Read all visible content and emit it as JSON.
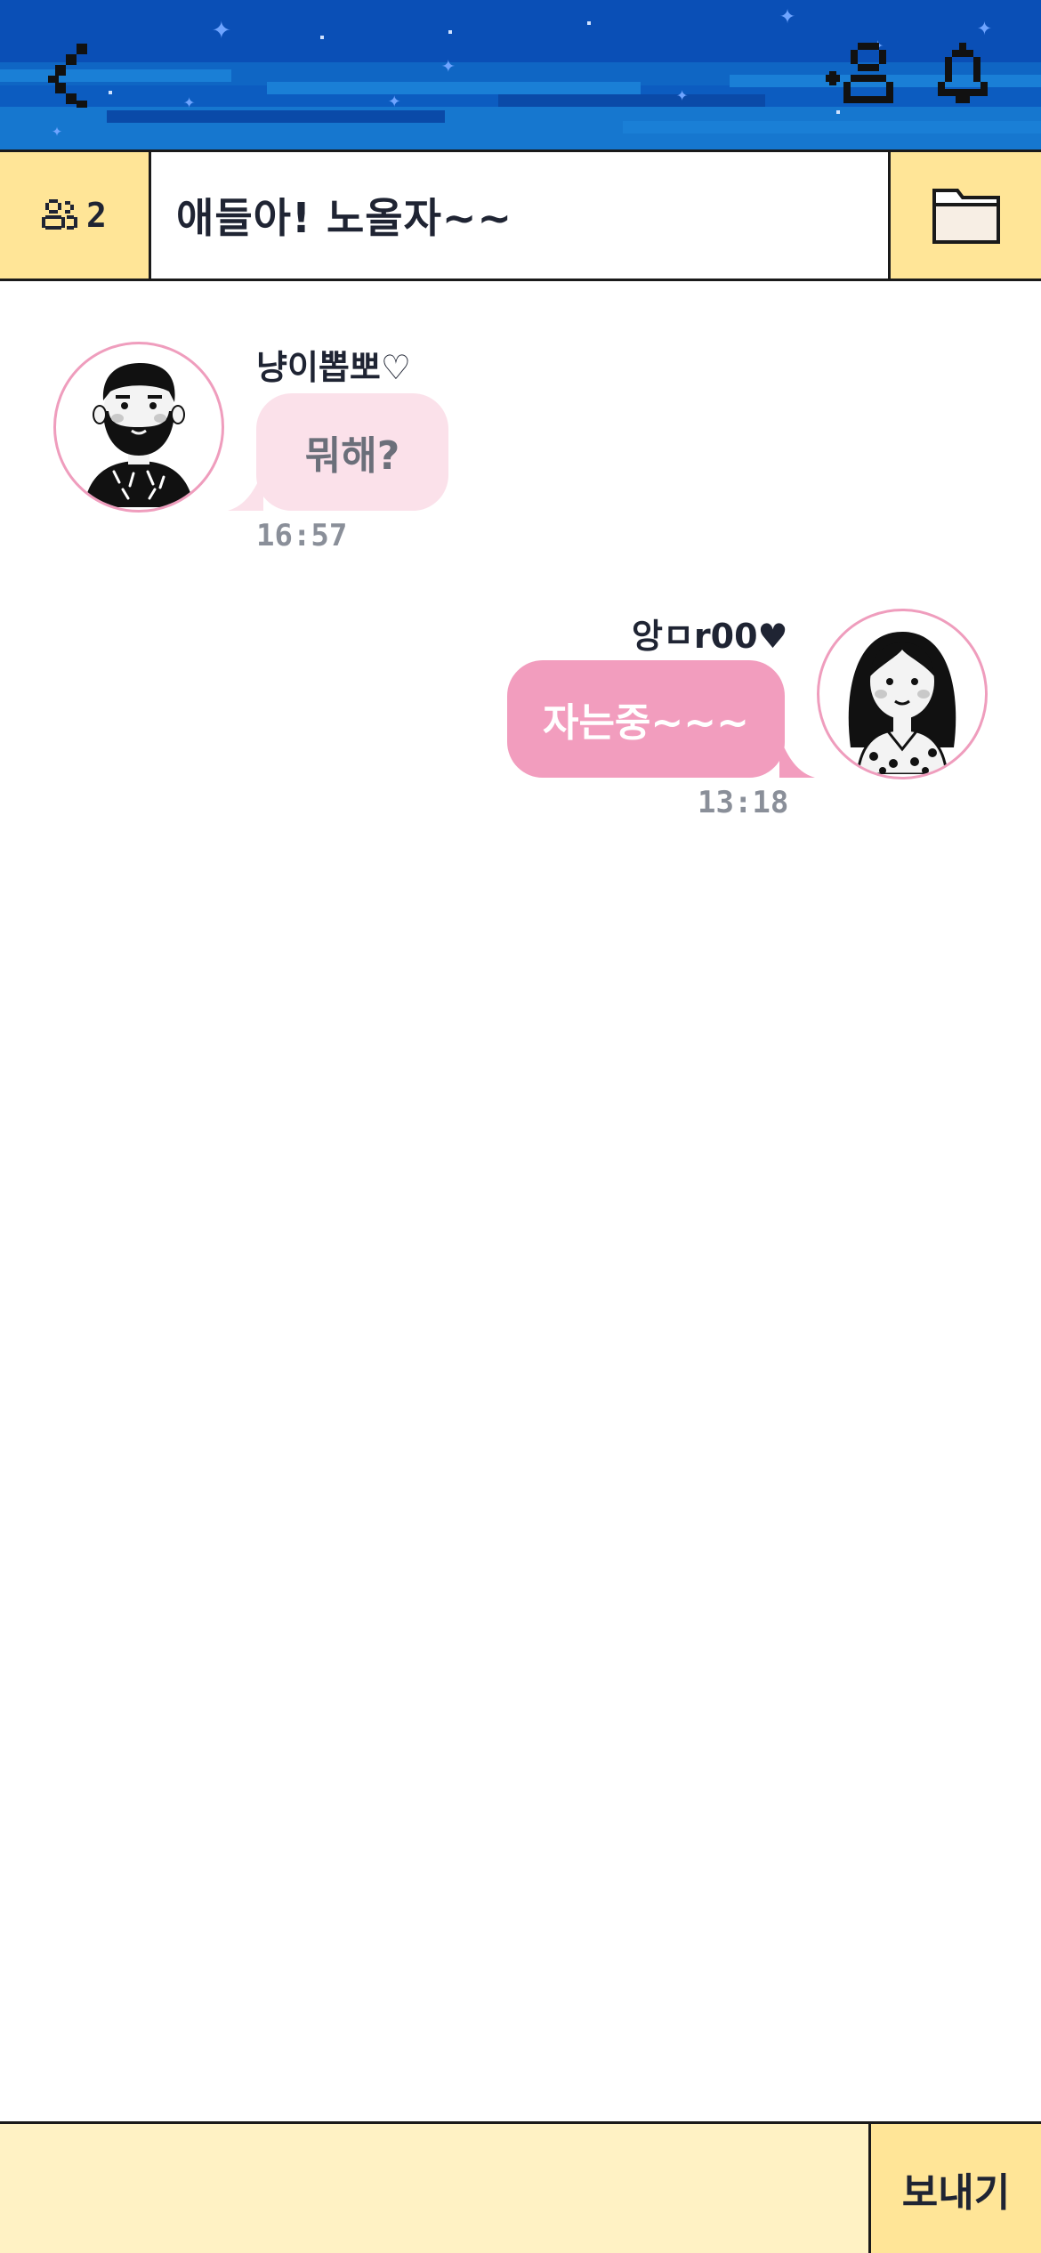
{
  "header": {
    "back_icon": "chevron-left-icon",
    "add_user_icon": "add-user-icon",
    "notification_icon": "bell-icon",
    "sky_color": "#0a4fb6"
  },
  "room": {
    "member_icon": "people-icon",
    "member_count": "2",
    "title": "애들아! 노올자~~",
    "folder_icon": "folder-icon",
    "accent": "#ffe597"
  },
  "messages": [
    {
      "direction": "incoming",
      "sender": "냥이뽑뽀♡",
      "text": "뭐해?",
      "time": "16:57",
      "avatar": "bearded-man-avatar",
      "bubble_color": "#fbe1ea"
    },
    {
      "direction": "outgoing",
      "sender": "앙ㅁr00♥",
      "text": "자는중~~~",
      "time": "13:18",
      "avatar": "long-hair-woman-avatar",
      "bubble_color": "#f29dbe"
    }
  ],
  "composer": {
    "placeholder": "",
    "send_label": "보내기",
    "background": "#fff2c4"
  }
}
